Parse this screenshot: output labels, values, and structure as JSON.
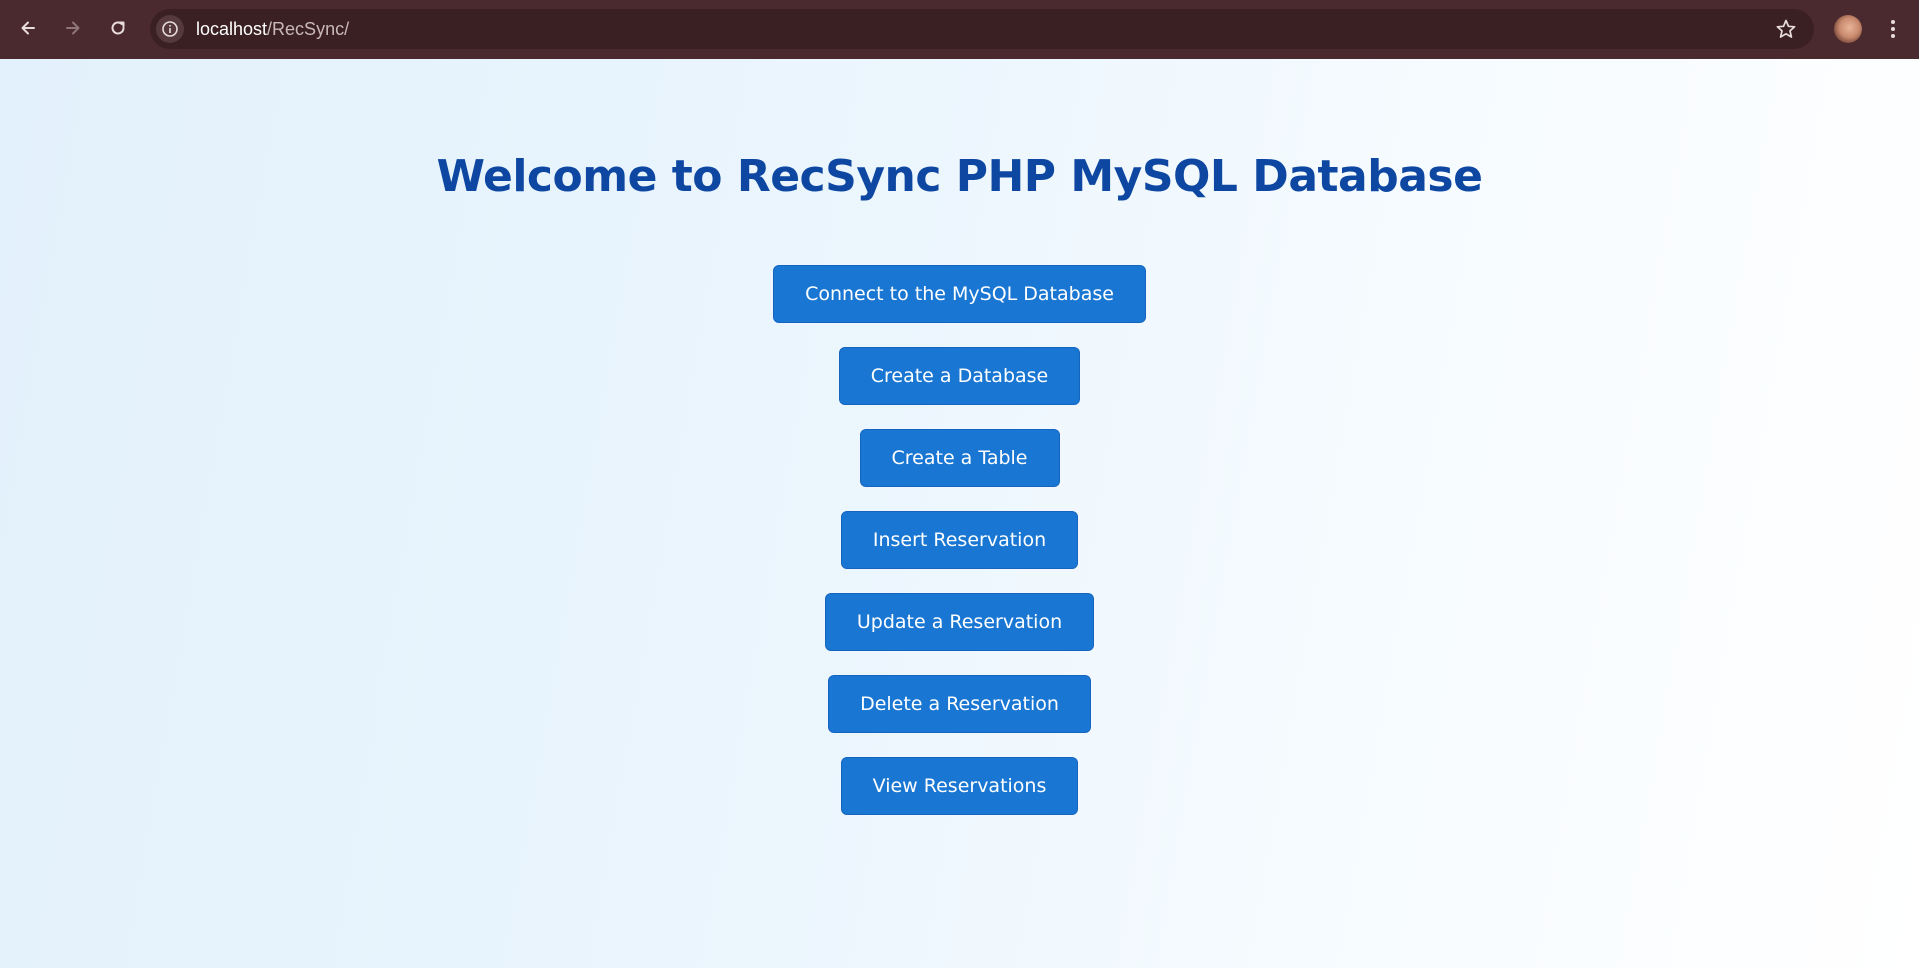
{
  "browser": {
    "url_host": "localhost",
    "url_path": "/RecSync/",
    "icons": {
      "back": "arrow-left-icon",
      "forward": "arrow-right-icon",
      "reload": "reload-icon",
      "site_info": "info-icon",
      "bookmark": "star-icon",
      "menu": "kebab-menu-icon"
    }
  },
  "page": {
    "title": "Welcome to RecSync PHP MySQL Database",
    "buttons": [
      {
        "label": "Connect to the MySQL Database"
      },
      {
        "label": "Create a Database"
      },
      {
        "label": "Create a Table"
      },
      {
        "label": "Insert Reservation"
      },
      {
        "label": "Update a Reservation"
      },
      {
        "label": "Delete a Reservation"
      },
      {
        "label": "View Reservations"
      }
    ]
  },
  "colors": {
    "chrome_bar": "#4a2a2e",
    "address_bar": "#3a2022",
    "title": "#0d47a1",
    "button": "#1976d2",
    "button_text": "#ffffff"
  }
}
